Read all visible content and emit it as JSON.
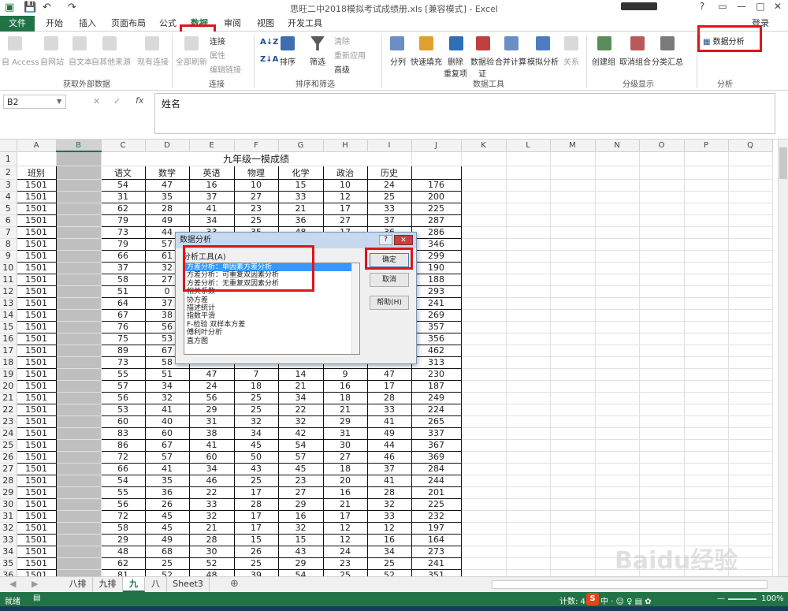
{
  "app": {
    "title": "思旺二中2018模拟考试成绩册.xls  [兼容模式] - Excel",
    "login": "登录"
  },
  "tabs": [
    {
      "label": "文件"
    },
    {
      "label": "开始"
    },
    {
      "label": "插入"
    },
    {
      "label": "页面布局"
    },
    {
      "label": "公式"
    },
    {
      "label": "数据"
    },
    {
      "label": "审阅"
    },
    {
      "label": "视图"
    },
    {
      "label": "开发工具"
    }
  ],
  "ribbon": {
    "ext": {
      "access": "自 Access",
      "web": "自网站",
      "text": "自文本",
      "other": "自其他来源",
      "existing": "现有连接",
      "group": "获取外部数据"
    },
    "conn": {
      "refresh": "全部刷新",
      "connections": "连接",
      "properties": "属性",
      "edit_links": "编辑链接",
      "group": "连接"
    },
    "sort": {
      "az": "A↓Z",
      "za": "Z↓A",
      "sort": "排序",
      "filter": "筛选",
      "clear": "清除",
      "reapply": "重新应用",
      "advanced": "高级",
      "group": "排序和筛选"
    },
    "tools": {
      "split": "分列",
      "flash": "快速填充",
      "dup": "删除",
      "dup2": "重复项",
      "valid": "数据验",
      "valid2": "证",
      "consolidate": "合并计算",
      "whatif": "模拟分析",
      "relation": "关系",
      "group": "数据工具"
    },
    "outline": {
      "create": "创建组",
      "ungroup": "取消组合",
      "subtotal": "分类汇总",
      "group": "分级显示"
    },
    "analysis": {
      "data_analysis": "数据分析",
      "group": "分析"
    }
  },
  "formula": {
    "cell_ref": "B2",
    "content": "姓名"
  },
  "columns": [
    "A",
    "B",
    "C",
    "D",
    "E",
    "F",
    "G",
    "H",
    "I",
    "J",
    "K",
    "L",
    "M",
    "N",
    "O",
    "P",
    "Q"
  ],
  "sheet_title": "九年级一模成绩",
  "headers": [
    "班别",
    "",
    "语文",
    "数学",
    "英语",
    "物理",
    "化学",
    "政治",
    "历史",
    ""
  ],
  "rows": [
    [
      "1501",
      "",
      "54",
      "47",
      "16",
      "10",
      "15",
      "10",
      "24",
      "176"
    ],
    [
      "1501",
      "",
      "31",
      "35",
      "37",
      "27",
      "33",
      "12",
      "25",
      "200"
    ],
    [
      "1501",
      "",
      "62",
      "28",
      "41",
      "23",
      "21",
      "17",
      "33",
      "225"
    ],
    [
      "1501",
      "",
      "79",
      "49",
      "34",
      "25",
      "36",
      "27",
      "37",
      "287"
    ],
    [
      "1501",
      "",
      "73",
      "44",
      "33",
      "35",
      "48",
      "17",
      "36",
      "286"
    ],
    [
      "1501",
      "",
      "79",
      "57",
      "",
      "",
      "",
      "",
      "",
      "346"
    ],
    [
      "1501",
      "",
      "66",
      "61",
      "",
      "",
      "",
      "",
      "",
      "299"
    ],
    [
      "1501",
      "",
      "37",
      "32",
      "",
      "",
      "",
      "",
      "",
      "190"
    ],
    [
      "1501",
      "",
      "58",
      "27",
      "",
      "",
      "",
      "",
      "",
      "188"
    ],
    [
      "1501",
      "",
      "51",
      "0",
      "",
      "",
      "",
      "",
      "",
      "293"
    ],
    [
      "1501",
      "",
      "64",
      "37",
      "",
      "",
      "",
      "",
      "",
      "241"
    ],
    [
      "1501",
      "",
      "67",
      "38",
      "",
      "",
      "",
      "",
      "",
      "269"
    ],
    [
      "1501",
      "",
      "76",
      "56",
      "",
      "",
      "",
      "",
      "",
      "357"
    ],
    [
      "1501",
      "",
      "75",
      "53",
      "",
      "",
      "",
      "",
      "",
      "356"
    ],
    [
      "1501",
      "",
      "89",
      "67",
      "",
      "",
      "",
      "",
      "",
      "462"
    ],
    [
      "1501",
      "",
      "73",
      "58",
      "",
      "",
      "",
      "",
      "",
      "313"
    ],
    [
      "1501",
      "",
      "55",
      "51",
      "47",
      "7",
      "14",
      "9",
      "47",
      "230"
    ],
    [
      "1501",
      "",
      "57",
      "34",
      "24",
      "18",
      "21",
      "16",
      "17",
      "187"
    ],
    [
      "1501",
      "",
      "56",
      "32",
      "56",
      "25",
      "34",
      "18",
      "28",
      "249"
    ],
    [
      "1501",
      "",
      "53",
      "41",
      "29",
      "25",
      "22",
      "21",
      "33",
      "224"
    ],
    [
      "1501",
      "",
      "60",
      "40",
      "31",
      "32",
      "32",
      "29",
      "41",
      "265"
    ],
    [
      "1501",
      "",
      "83",
      "60",
      "38",
      "34",
      "42",
      "31",
      "49",
      "337"
    ],
    [
      "1501",
      "",
      "86",
      "67",
      "41",
      "45",
      "54",
      "30",
      "44",
      "367"
    ],
    [
      "1501",
      "",
      "72",
      "57",
      "60",
      "50",
      "57",
      "27",
      "46",
      "369"
    ],
    [
      "1501",
      "",
      "66",
      "41",
      "34",
      "43",
      "45",
      "18",
      "37",
      "284"
    ],
    [
      "1501",
      "",
      "54",
      "35",
      "46",
      "25",
      "23",
      "20",
      "41",
      "244"
    ],
    [
      "1501",
      "",
      "55",
      "36",
      "22",
      "17",
      "27",
      "16",
      "28",
      "201"
    ],
    [
      "1501",
      "",
      "56",
      "26",
      "33",
      "28",
      "29",
      "21",
      "32",
      "225"
    ],
    [
      "1501",
      "",
      "72",
      "45",
      "32",
      "17",
      "16",
      "17",
      "33",
      "232"
    ],
    [
      "1501",
      "",
      "58",
      "45",
      "21",
      "17",
      "32",
      "12",
      "12",
      "197"
    ],
    [
      "1501",
      "",
      "29",
      "49",
      "28",
      "15",
      "15",
      "12",
      "16",
      "164"
    ],
    [
      "1501",
      "",
      "48",
      "68",
      "30",
      "26",
      "43",
      "24",
      "34",
      "273"
    ],
    [
      "1501",
      "",
      "62",
      "25",
      "52",
      "25",
      "29",
      "23",
      "25",
      "241"
    ],
    [
      "1501",
      "",
      "81",
      "52",
      "48",
      "39",
      "54",
      "25",
      "52",
      "351"
    ]
  ],
  "dialog": {
    "title": "数据分析",
    "tools_label": "分析工具(A)",
    "items": [
      "方差分析：单因素方差分析",
      "方差分析：可重复双因素分析",
      "方差分析：无重复双因素分析",
      "相关系数",
      "协方差",
      "描述统计",
      "指数平滑",
      "F-检验 双样本方差",
      "傅利叶分析",
      "直方图"
    ],
    "ok": "确定",
    "cancel": "取消",
    "help": "帮助(H)"
  },
  "sheets": [
    "八排",
    "九排",
    "九",
    "八",
    "Sheet3"
  ],
  "status": {
    "ready": "就绪",
    "count": "计数: 4",
    "zoom": "100%"
  },
  "watermark": "Baidu经验"
}
